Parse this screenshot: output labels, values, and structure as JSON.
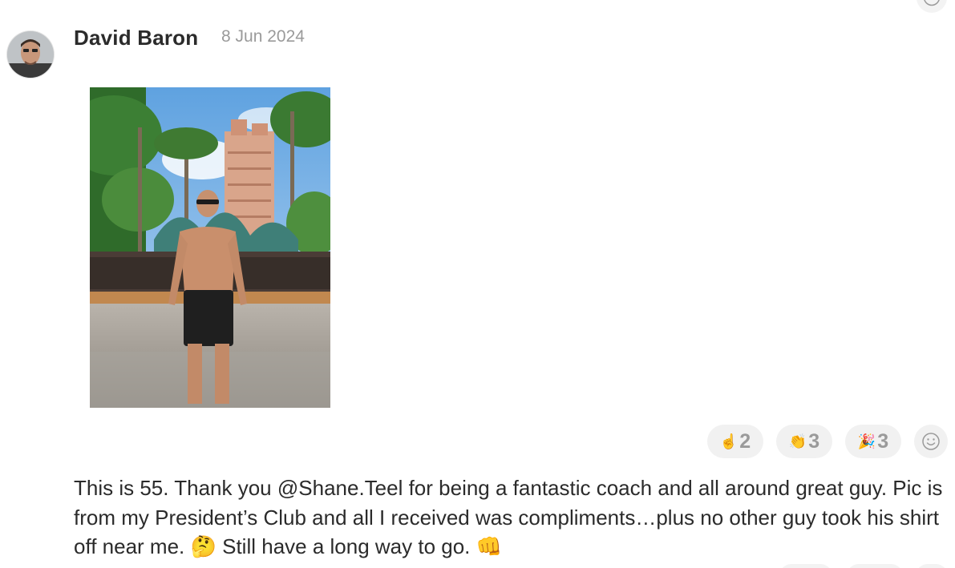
{
  "post": {
    "author": "David Baron",
    "date": "8 Jun 2024",
    "message_parts": {
      "p1": "This is 55. Thank you @Shane.Teel for being a fantastic coach and all around great guy. Pic is from my President’s Club and all I received was compliments…plus no other guy took his shirt off near me.",
      "emoji1": "🤔",
      "p2": "Still have a long way to go.",
      "emoji2": "👊"
    }
  },
  "reactions": [
    {
      "icon": "pointing-finger-icon",
      "glyph": "☝",
      "count": "2"
    },
    {
      "icon": "clapping-hands-icon",
      "glyph": "👏",
      "count": "3"
    },
    {
      "icon": "party-popper-icon",
      "glyph": "🎉",
      "count": "3"
    }
  ],
  "icons": {
    "add_reaction": "smiley-face-icon",
    "avatar": "avatar"
  },
  "colors": {
    "text": "#2b2b2b",
    "muted": "#9a9a9a",
    "pill": "#f1f1f1"
  }
}
